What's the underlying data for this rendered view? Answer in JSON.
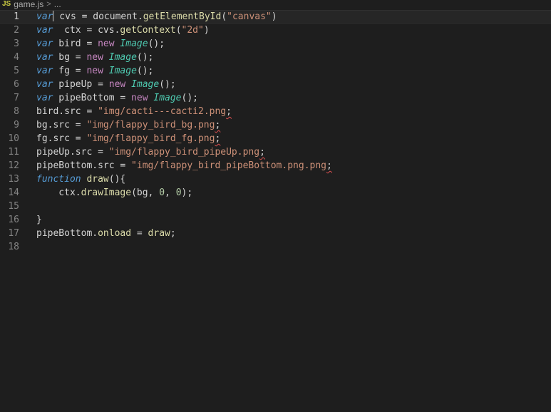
{
  "breadcrumb": {
    "lang_badge": "JS",
    "file": "game.js",
    "separator": ">",
    "ellipsis": "..."
  },
  "lines": [
    {
      "n": "1",
      "tokens": [
        [
          "kw-var",
          "var"
        ],
        [
          "cursor",
          ""
        ],
        [
          "ident",
          " cvs "
        ],
        [
          "op",
          "="
        ],
        [
          "ident",
          " document."
        ],
        [
          "meth",
          "getElementById"
        ],
        [
          "pun",
          "("
        ],
        [
          "str",
          "\"canvas\""
        ],
        [
          "pun",
          ")"
        ]
      ]
    },
    {
      "n": "2",
      "tokens": [
        [
          "kw-var",
          "var"
        ],
        [
          "ident",
          "  ctx "
        ],
        [
          "op",
          "="
        ],
        [
          "ident",
          " cvs."
        ],
        [
          "meth",
          "getContext"
        ],
        [
          "pun",
          "("
        ],
        [
          "str",
          "\"2d\""
        ],
        [
          "pun",
          ")"
        ]
      ]
    },
    {
      "n": "3",
      "tokens": [
        [
          "kw-var",
          "var"
        ],
        [
          "ident",
          " bird "
        ],
        [
          "op",
          "="
        ],
        [
          "kw-new",
          " new "
        ],
        [
          "cls",
          "Image"
        ],
        [
          "pun",
          "();"
        ]
      ]
    },
    {
      "n": "4",
      "tokens": [
        [
          "kw-var",
          "var"
        ],
        [
          "ident",
          " bg "
        ],
        [
          "op",
          "="
        ],
        [
          "kw-new",
          " new "
        ],
        [
          "cls",
          "Image"
        ],
        [
          "pun",
          "();"
        ]
      ]
    },
    {
      "n": "5",
      "tokens": [
        [
          "kw-var",
          "var"
        ],
        [
          "ident",
          " fg "
        ],
        [
          "op",
          "="
        ],
        [
          "kw-new",
          " new "
        ],
        [
          "cls",
          "Image"
        ],
        [
          "pun",
          "();"
        ]
      ]
    },
    {
      "n": "6",
      "tokens": [
        [
          "kw-var",
          "var"
        ],
        [
          "ident",
          " pipeUp "
        ],
        [
          "op",
          "="
        ],
        [
          "kw-new",
          " new "
        ],
        [
          "cls",
          "Image"
        ],
        [
          "pun",
          "();"
        ]
      ]
    },
    {
      "n": "7",
      "tokens": [
        [
          "kw-var",
          "var"
        ],
        [
          "ident",
          " pipeBottom "
        ],
        [
          "op",
          "="
        ],
        [
          "kw-new",
          " new "
        ],
        [
          "cls",
          "Image"
        ],
        [
          "pun",
          "();"
        ]
      ]
    },
    {
      "n": "8",
      "tokens": [
        [
          "ident",
          "bird.src "
        ],
        [
          "op",
          "="
        ],
        [
          "str",
          " \"img/cacti---cacti2.png"
        ],
        [
          "squig",
          ";"
        ]
      ]
    },
    {
      "n": "9",
      "tokens": [
        [
          "ident",
          "bg.src "
        ],
        [
          "op",
          "="
        ],
        [
          "str",
          " \"img/flappy_bird_bg.png"
        ],
        [
          "squig",
          ";"
        ]
      ]
    },
    {
      "n": "10",
      "tokens": [
        [
          "ident",
          "fg.src "
        ],
        [
          "op",
          "="
        ],
        [
          "str",
          " \"img/flappy_bird_fg.png"
        ],
        [
          "squig",
          ";"
        ]
      ]
    },
    {
      "n": "11",
      "tokens": [
        [
          "ident",
          "pipeUp.src "
        ],
        [
          "op",
          "="
        ],
        [
          "str",
          " \"img/flappy_bird_pipeUp.png"
        ],
        [
          "squig",
          ";"
        ]
      ]
    },
    {
      "n": "12",
      "tokens": [
        [
          "ident",
          "pipeBottom.src "
        ],
        [
          "op",
          "="
        ],
        [
          "str",
          " \"img/flappy_bird_pipeBottom.png.png"
        ],
        [
          "squig",
          ";"
        ]
      ]
    },
    {
      "n": "13",
      "tokens": [
        [
          "kw-fn",
          "function"
        ],
        [
          "meth",
          " draw"
        ],
        [
          "pun",
          "(){"
        ]
      ]
    },
    {
      "n": "14",
      "tokens": [
        [
          "ident",
          "    ctx."
        ],
        [
          "meth",
          "drawImage"
        ],
        [
          "pun",
          "("
        ],
        [
          "ident",
          "bg, "
        ],
        [
          "num",
          "0"
        ],
        [
          "pun",
          ", "
        ],
        [
          "num",
          "0"
        ],
        [
          "pun",
          ");"
        ]
      ]
    },
    {
      "n": "15",
      "tokens": []
    },
    {
      "n": "16",
      "tokens": [
        [
          "pun",
          "}"
        ]
      ]
    },
    {
      "n": "17",
      "tokens": [
        [
          "ident",
          "pipeBottom."
        ],
        [
          "meth",
          "onload"
        ],
        [
          "ident",
          " "
        ],
        [
          "op",
          "="
        ],
        [
          "meth",
          " draw"
        ],
        [
          "pun",
          ";"
        ]
      ]
    },
    {
      "n": "18",
      "tokens": []
    }
  ],
  "current_line": "1"
}
